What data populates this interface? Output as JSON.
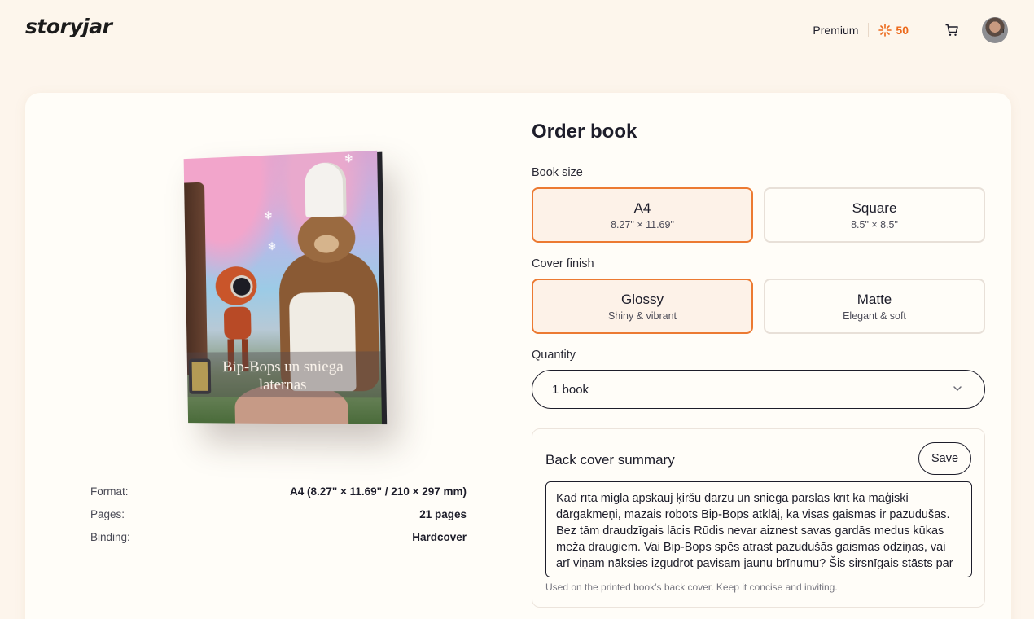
{
  "header": {
    "logo": "storyjar",
    "premium_label": "Premium",
    "credits": "50",
    "credits_icon": "sparkle-icon",
    "cart_icon": "cart-icon",
    "avatar": "user-avatar"
  },
  "book": {
    "cover_title": "Bip-Bops un sniega laternas"
  },
  "specs": [
    {
      "label": "Format:",
      "value": "A4 (8.27\" × 11.69\" / 210 × 297 mm)"
    },
    {
      "label": "Pages:",
      "value": "21 pages"
    },
    {
      "label": "Binding:",
      "value": "Hardcover"
    }
  ],
  "order": {
    "title": "Order book",
    "book_size_label": "Book size",
    "sizes": [
      {
        "title": "A4",
        "sub": "8.27\" × 11.69\"",
        "selected": true
      },
      {
        "title": "Square",
        "sub": "8.5\" × 8.5\"",
        "selected": false
      }
    ],
    "cover_finish_label": "Cover finish",
    "finishes": [
      {
        "title": "Glossy",
        "sub": "Shiny & vibrant",
        "selected": true
      },
      {
        "title": "Matte",
        "sub": "Elegant & soft",
        "selected": false
      }
    ],
    "quantity_label": "Quantity",
    "quantity_value": "1 book",
    "summary_title": "Back cover summary",
    "save_label": "Save",
    "summary_text": "Kad rīta migla apskauj ķiršu dārzu un sniega pārslas krīt kā maģiski dārgakmeņi, mazais robots Bip-Bops atklāj, ka visas gaismas ir pazudušas. Bez tām draudzīgais lācis Rūdis nevar aiznest savas gardās medus kūkas meža draugiem. Vai Bip-Bops spēs atrast pazudušās gaismas odziņas, vai arī viņam nāksies izgudrot pavisam jaunu brīnumu? Šis sirsnīgais stāsts par",
    "summary_hint": "Used on the printed book’s back cover. Keep it concise and inviting."
  },
  "colors": {
    "accent": "#ec7a32",
    "selected_bg": "#fdf2e8",
    "page_bg": "#fdf5ec"
  }
}
